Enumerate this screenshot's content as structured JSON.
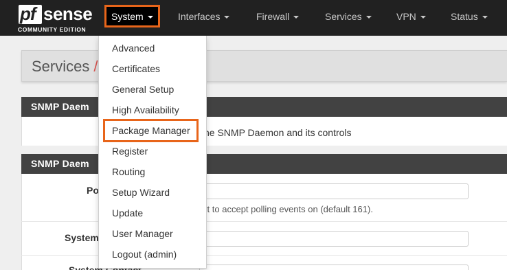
{
  "brand": {
    "logo_pf": "pf",
    "logo_sense": "sense",
    "edition": "COMMUNITY EDITION"
  },
  "nav": {
    "items": [
      {
        "label": "System"
      },
      {
        "label": "Interfaces"
      },
      {
        "label": "Firewall"
      },
      {
        "label": "Services"
      },
      {
        "label": "VPN"
      },
      {
        "label": "Status"
      }
    ]
  },
  "page": {
    "breadcrumb_root": "Services",
    "breadcrumb_sep": "/"
  },
  "panels": {
    "daemon_head": "SNMP Daem",
    "daemon_text": "he SNMP Daemon and its controls",
    "daemon2_head": "SNMP Daem"
  },
  "form": {
    "poll_label": "Po",
    "poll_help": "ort to accept polling events on (default 161).",
    "syslocation_label": "System",
    "syscontact_label": "System Contact"
  },
  "system_menu": {
    "items": [
      {
        "label": "Advanced"
      },
      {
        "label": "Certificates"
      },
      {
        "label": "General Setup"
      },
      {
        "label": "High Availability"
      },
      {
        "label": "Package Manager"
      },
      {
        "label": "Register"
      },
      {
        "label": "Routing"
      },
      {
        "label": "Setup Wizard"
      },
      {
        "label": "Update"
      },
      {
        "label": "User Manager"
      },
      {
        "label": "Logout (admin)"
      }
    ],
    "highlighted": "Package Manager"
  },
  "colors": {
    "navbar": "#212121",
    "highlight": "#e8651a",
    "panel_head": "#424242",
    "breadcrumb_sep": "#d9534f"
  }
}
